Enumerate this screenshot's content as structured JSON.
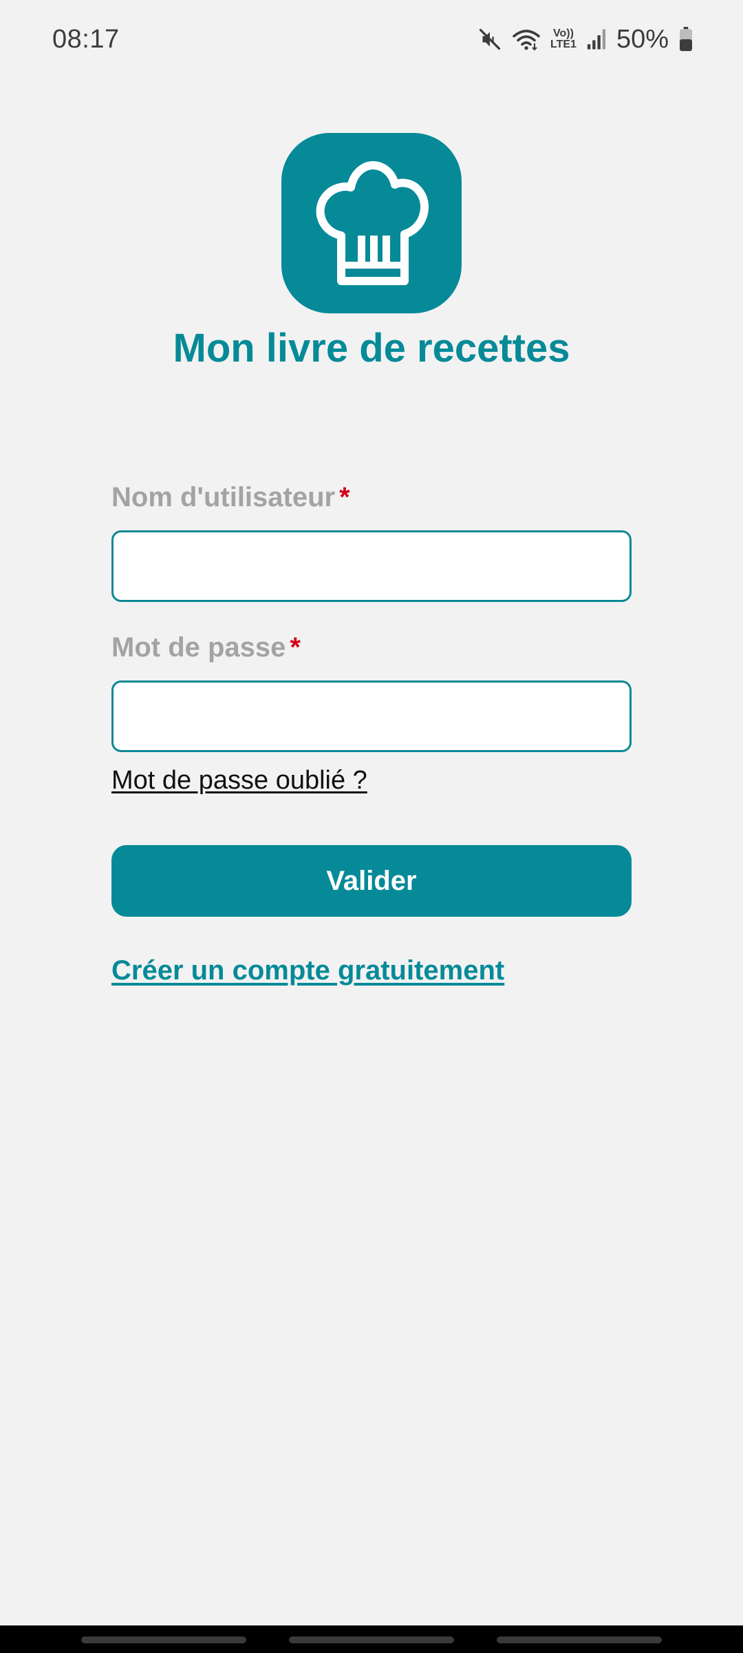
{
  "status_bar": {
    "time": "08:17",
    "volte_top": "Vo))",
    "volte_bottom": "LTE1",
    "battery_percent": "50%",
    "icons": [
      "mute-icon",
      "wifi-icon",
      "volte-icon",
      "signal-icon",
      "battery-icon"
    ]
  },
  "app": {
    "logo_icon": "chef-hat-icon",
    "title": "Mon livre de recettes"
  },
  "form": {
    "username_label": "Nom d'utilisateur",
    "username_value": "",
    "password_label": "Mot de passe",
    "password_value": "",
    "required_marker": "*",
    "forgot_password": "Mot de passe oublié ?",
    "submit_label": "Valider",
    "signup_link": "Créer un compte gratuitement"
  },
  "colors": {
    "accent": "#068a98",
    "background": "#f2f2f2",
    "label": "#a3a3a3",
    "required": "#d0021b"
  }
}
